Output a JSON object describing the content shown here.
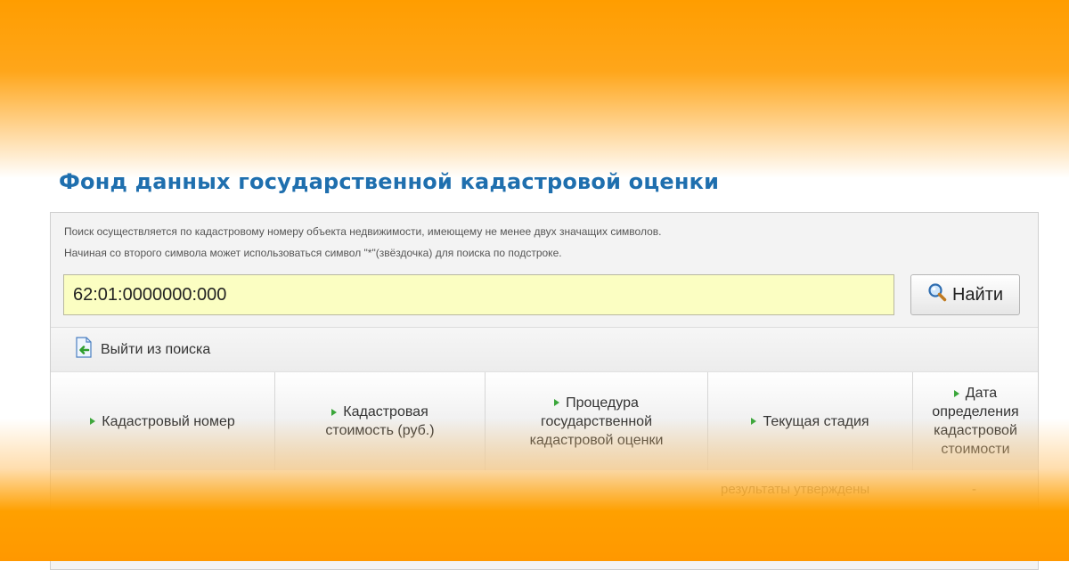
{
  "page": {
    "title": "Фонд данных государственной кадастровой оценки"
  },
  "search": {
    "hint_line1": "Поиск осуществляется по кадастровому номеру объекта недвижимости, имеющему не менее двух значащих символов.",
    "hint_line2": "Начиная со второго символа может использоваться символ \"*\"(звёздочка) для поиска по подстроке.",
    "value": "62:01:0000000:000",
    "button_label": "Найти",
    "button_icon": "search-icon"
  },
  "exit": {
    "label": "Выйти из поиска",
    "icon": "exit-search-icon"
  },
  "table": {
    "columns": [
      [
        "Кадастровый номер"
      ],
      [
        "Кадастровая",
        "стоимость (руб.)"
      ],
      [
        "Процедура",
        "государственной",
        "кадастровой оценки"
      ],
      [
        "Текущая стадия"
      ],
      [
        "Дата",
        "определения",
        "кадастровой",
        "стоимости"
      ]
    ],
    "rows": [
      {
        "stage": "результаты утверждены",
        "date": "-"
      }
    ]
  },
  "colors": {
    "accent": "#1f6fae",
    "background_orange": "#ff9d00",
    "input_bg": "#fbfec2",
    "arrow_green": "#3aa63a"
  }
}
